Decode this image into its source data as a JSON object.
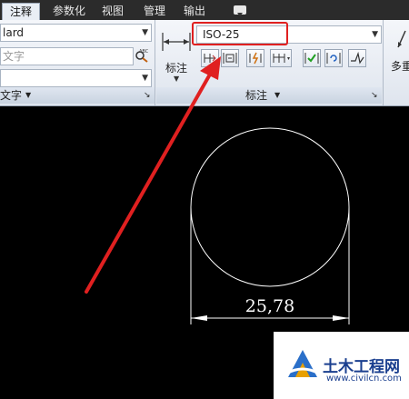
{
  "tabs": [
    {
      "label": "注释",
      "active": true
    },
    {
      "label": "参数化",
      "active": false
    },
    {
      "label": "视图",
      "active": false
    },
    {
      "label": "管理",
      "active": false
    },
    {
      "label": "输出",
      "active": false
    }
  ],
  "left_panel": {
    "style_value": "lard",
    "text_placeholder": "文字",
    "panel_label": "文字"
  },
  "dim_panel": {
    "big_button_label": "标注",
    "dim_style_value": "ISO-25",
    "panel_label": "标注"
  },
  "right_panel": {
    "label": "多重"
  },
  "drawing": {
    "dimension_text": "25,78"
  },
  "watermark": {
    "title": "土木工程网",
    "url": "www.civilcn.com"
  },
  "colors": {
    "highlight": "#e02020",
    "arrow": "#e02020",
    "canvas_bg": "#000000",
    "drawing_line": "#ffffff"
  }
}
